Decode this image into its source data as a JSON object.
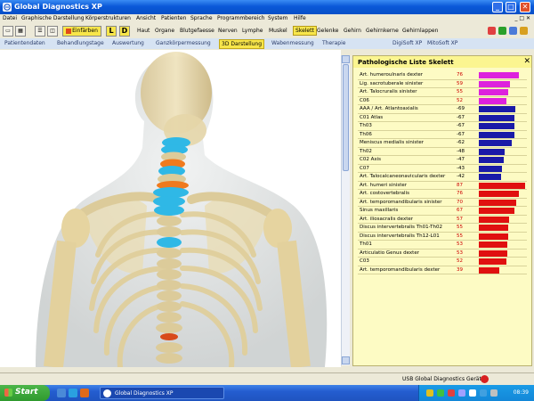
{
  "window": {
    "title": "Global Diagnostics XP"
  },
  "menu": {
    "items": [
      "Datei",
      "Graphische Darstellung",
      "Körperstrukturen",
      "Ansicht",
      "Patienten",
      "Sprache",
      "Programmbereich",
      "System",
      "Hilfe"
    ]
  },
  "toolbar": {
    "color_button": "Einfärben",
    "left_letter": "L",
    "right_letter": "D",
    "categories": [
      "Haut",
      "Organe",
      "Blutgefaesse",
      "Nerven",
      "Lymphe",
      "Muskel",
      "Skelett",
      "Gelenke",
      "Gehirn",
      "Gehirnkerne",
      "Gehirnlappen"
    ],
    "selected_category": "Skelett"
  },
  "tabs": {
    "items": [
      "Patientendaten",
      "Behandlungstage",
      "Auswertung",
      "Ganzkörpermessung",
      "3D Darstellung",
      "Wabenmessung",
      "Therapie",
      "DigiSoft XP",
      "MitoSoft XP"
    ],
    "active": "3D Darstellung"
  },
  "panel": {
    "title": "Pathologische Liste Skelett",
    "close": "✕",
    "max_abs": 87,
    "rows": [
      {
        "name": "Art. humeroulnaris dexter",
        "value": 76,
        "color": "#dd22dd",
        "value_color": "#cc0000"
      },
      {
        "name": "Lig. sacrotuberale sinister",
        "value": 59,
        "color": "#dd22dd",
        "value_color": "#cc0000"
      },
      {
        "name": "Art. Talocruralis sinister",
        "value": 55,
        "color": "#dd22dd",
        "value_color": "#cc0000"
      },
      {
        "name": "C06",
        "value": 52,
        "color": "#dd22dd",
        "value_color": "#cc0000"
      },
      {
        "name": "AAA / Art. Atlantoaxialis",
        "value": -69,
        "color": "#1a1aa8",
        "value_color": "#000000"
      },
      {
        "name": "C01 Atlas",
        "value": -67,
        "color": "#1a1aa8",
        "value_color": "#000000"
      },
      {
        "name": "Th03",
        "value": -67,
        "color": "#1a1aa8",
        "value_color": "#000000"
      },
      {
        "name": "Th06",
        "value": -67,
        "color": "#1a1aa8",
        "value_color": "#000000"
      },
      {
        "name": "Meniscus medialis sinister",
        "value": -62,
        "color": "#1a1aa8",
        "value_color": "#000000"
      },
      {
        "name": "Th02",
        "value": -48,
        "color": "#1a1aa8",
        "value_color": "#000000"
      },
      {
        "name": "C02 Axis",
        "value": -47,
        "color": "#1a1aa8",
        "value_color": "#000000"
      },
      {
        "name": "C07",
        "value": -43,
        "color": "#1a1aa8",
        "value_color": "#000000"
      },
      {
        "name": "Art. Talocalcaneonavicularis dexter",
        "value": -42,
        "color": "#1a1aa8",
        "value_color": "#000000"
      },
      {
        "name": "Art. humeri sinister",
        "value": 87,
        "color": "#e01010",
        "value_color": "#cc0000"
      },
      {
        "name": "Art. costovertebralis",
        "value": 76,
        "color": "#e01010",
        "value_color": "#cc0000"
      },
      {
        "name": "Art. temporomandibularis sinister",
        "value": 70,
        "color": "#e01010",
        "value_color": "#cc0000"
      },
      {
        "name": "Sinus maxillaris",
        "value": 67,
        "color": "#e01010",
        "value_color": "#cc0000"
      },
      {
        "name": "Art. iliosacralis dexter",
        "value": 57,
        "color": "#e01010",
        "value_color": "#cc0000"
      },
      {
        "name": "Discus intervertebralis Th01-Th02",
        "value": 55,
        "color": "#e01010",
        "value_color": "#cc0000"
      },
      {
        "name": "Discus intervertebralis Th12-L01",
        "value": 55,
        "color": "#e01010",
        "value_color": "#cc0000"
      },
      {
        "name": "Th01",
        "value": 53,
        "color": "#e01010",
        "value_color": "#cc0000"
      },
      {
        "name": "Articulatio Genus dexter",
        "value": 53,
        "color": "#e01010",
        "value_color": "#cc0000"
      },
      {
        "name": "C03",
        "value": 52,
        "color": "#e01010",
        "value_color": "#cc0000"
      },
      {
        "name": "Art. temporomandibularis dexter",
        "value": 39,
        "color": "#e01010",
        "value_color": "#cc0000"
      }
    ]
  },
  "statusbar": {
    "text": "USB Global Diagnostics Gerät"
  },
  "taskbar": {
    "start": "Start",
    "task": "Global Diagnostics XP",
    "clock": "08:39"
  }
}
